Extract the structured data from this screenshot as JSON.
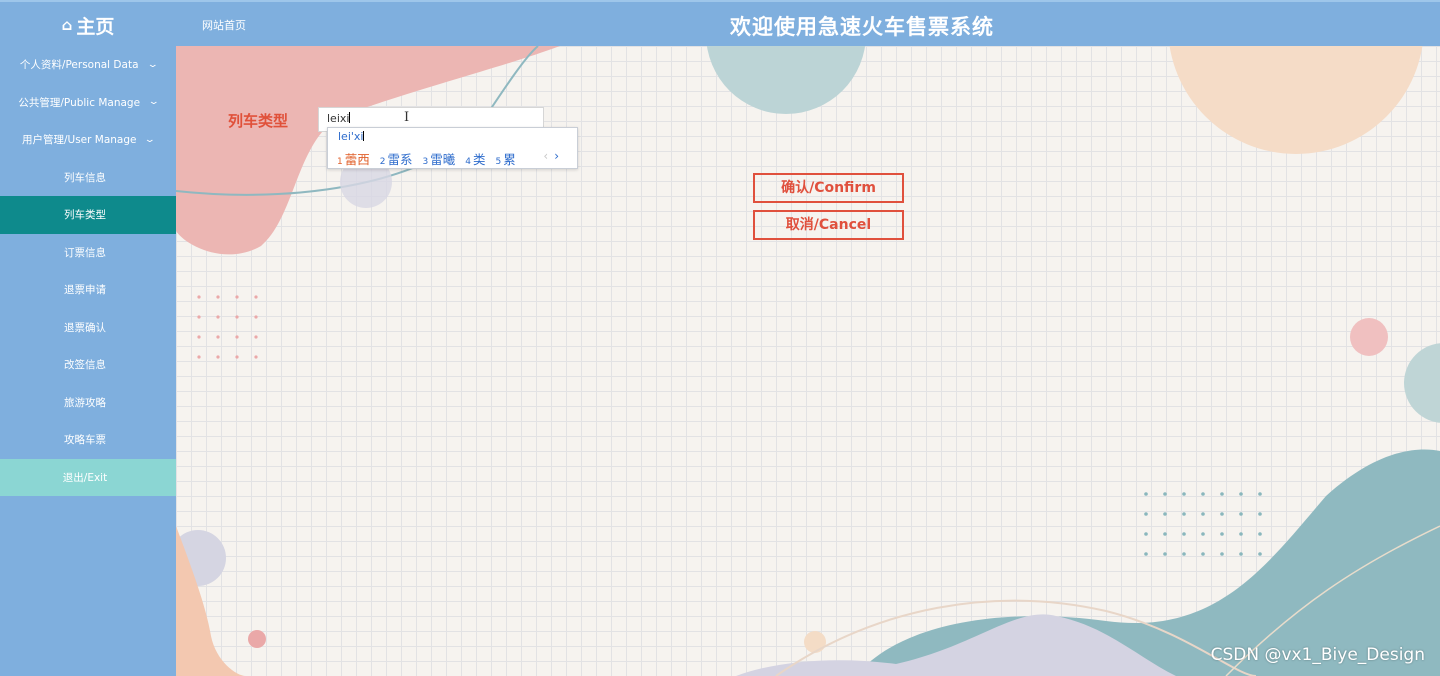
{
  "header": {
    "brand_icon": "home-icon",
    "brand_label": "主页",
    "site_link": "网站首页",
    "title": "欢迎使用急速火车售票系统"
  },
  "sidebar": {
    "groups": [
      {
        "label": "个人资料/Personal Data",
        "icon": "chevron-down-icon"
      },
      {
        "label": "公共管理/Public Manage",
        "icon": "chevron-down-icon"
      },
      {
        "label": "用户管理/User Manage",
        "icon": "chevron-down-icon"
      }
    ],
    "items": [
      {
        "label": "列车信息"
      },
      {
        "label": "列车类型",
        "active": true
      },
      {
        "label": "订票信息"
      },
      {
        "label": "退票申请"
      },
      {
        "label": "退票确认"
      },
      {
        "label": "改签信息"
      },
      {
        "label": "旅游攻略"
      },
      {
        "label": "攻略车票"
      },
      {
        "label": "退出/Exit"
      }
    ],
    "bg_color": "#7fafde",
    "active_color": "#0e8a8c",
    "exit_color": "#8bd6d3"
  },
  "form": {
    "label": "列车类型",
    "input_value": "leixi",
    "confirm_label": "确认/Confirm",
    "cancel_label": "取消/Cancel",
    "accent_color": "#e0503d"
  },
  "ime": {
    "composition": "lei'xi",
    "candidates": [
      {
        "num": "1",
        "text": "蕾西"
      },
      {
        "num": "2",
        "text": "雷系"
      },
      {
        "num": "3",
        "text": "雷曦"
      },
      {
        "num": "4",
        "text": "类"
      },
      {
        "num": "5",
        "text": "累"
      }
    ],
    "prev": "‹",
    "next": "›"
  },
  "watermark": "CSDN @vx1_Biye_Design"
}
